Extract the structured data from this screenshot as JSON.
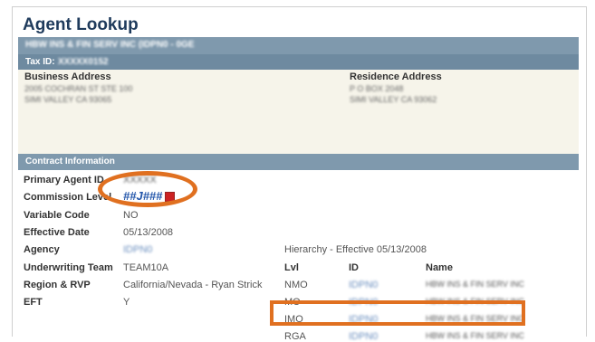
{
  "page": {
    "title": "Agent Lookup"
  },
  "header": {
    "agency_name": "HBW INS & FIN SERV INC (IDPN0 - 0GE",
    "tax_id_label": "Tax ID:",
    "tax_id_value": "XXXXX0152"
  },
  "address": {
    "business_label": "Business Address",
    "business_line1": "2005 COCHRAN ST STE 100",
    "business_line2": "SIMI VALLEY CA 93065",
    "residence_label": "Residence Address",
    "residence_line1": "P O BOX 2048",
    "residence_line2": "SIMI VALLEY CA 93062"
  },
  "contract": {
    "section_title": "Contract Information",
    "primary_agent_label": "Primary Agent ID",
    "primary_agent_value": "XXXXX",
    "commission_label": "Commission Level",
    "commission_value": "##J###",
    "variable_code_label": "Variable Code",
    "variable_code_value": "NO",
    "effective_date_label": "Effective Date",
    "effective_date_value": "05/13/2008",
    "agency_label": "Agency",
    "agency_value": "IDPN0",
    "underwriting_label": "Underwriting Team",
    "underwriting_value": "TEAM10A",
    "region_label": "Region & RVP",
    "region_value": "California/Nevada - Ryan Strick",
    "eft_label": "EFT",
    "eft_value": "Y"
  },
  "hierarchy": {
    "title": "Hierarchy - Effective 05/13/2008",
    "col_lvl": "Lvl",
    "col_id": "ID",
    "col_name": "Name",
    "rows": [
      {
        "lvl": "NMO",
        "id": "IDPN0",
        "name": "HBW INS & FIN SERV INC"
      },
      {
        "lvl": "MO",
        "id": "IDPN0",
        "name": "HBW INS & FIN SERV INC"
      },
      {
        "lvl": "IMO",
        "id": "IDPN0",
        "name": "HBW INS & FIN SERV INC"
      },
      {
        "lvl": "RGA",
        "id": "IDPN0",
        "name": "HBW INS & FIN SERV INC"
      }
    ]
  }
}
